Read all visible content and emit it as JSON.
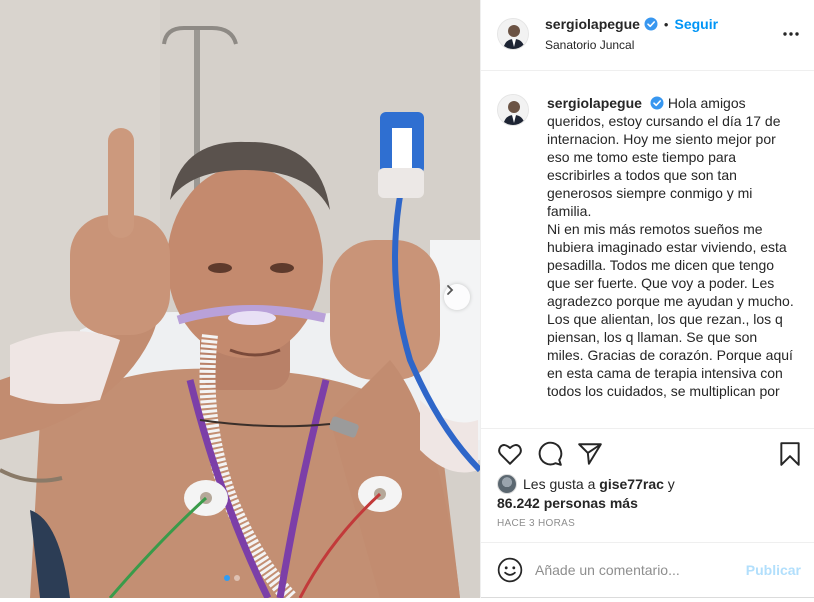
{
  "post": {
    "username": "sergiolapegue",
    "verified": true,
    "follow_label": "Seguir",
    "separator": "•",
    "location": "Sanatorio Juncal",
    "caption": "Hola amigos queridos, estoy cursando el día 17 de internacion. Hoy me siento mejor por eso me tomo este tiempo para escribirles a todos que son tan generosos siempre conmigo y mi familia.\nNi en mis más remotos sueños me hubiera imaginado estar viviendo, esta pesadilla. Todos me dicen que tengo que ser fuerte. Que voy a poder. Les agradezco porque me ayudan y mucho. Los que alientan, los que rezan., los q piensan, los q llaman. Se que son miles. Gracias de corazón. Porque aquí en esta cama de terapia intensiva con todos los cuidados, se multiplican por ",
    "likes": {
      "prefix": "Les gusta a",
      "first_user": "gise77rac",
      "conjunction": "y",
      "others": "86.242 personas más"
    },
    "timestamp": "HACE 3 HORAS",
    "carousel": {
      "slides": 2,
      "current": 1
    }
  },
  "comment": {
    "placeholder": "Añade un comentario...",
    "publish_label": "Publicar"
  },
  "icons": {
    "more": "more-options-icon",
    "like": "heart-icon",
    "comment": "comment-icon",
    "share": "paper-plane-icon",
    "save": "bookmark-icon",
    "emoji": "emoji-icon",
    "verified": "verified-badge-icon",
    "carousel_next": "chevron-right-icon"
  },
  "colors": {
    "accent": "#0095f6",
    "verified": "#3897f0",
    "publish_disabled": "#b2dffc",
    "muted": "#8e8e8e"
  }
}
